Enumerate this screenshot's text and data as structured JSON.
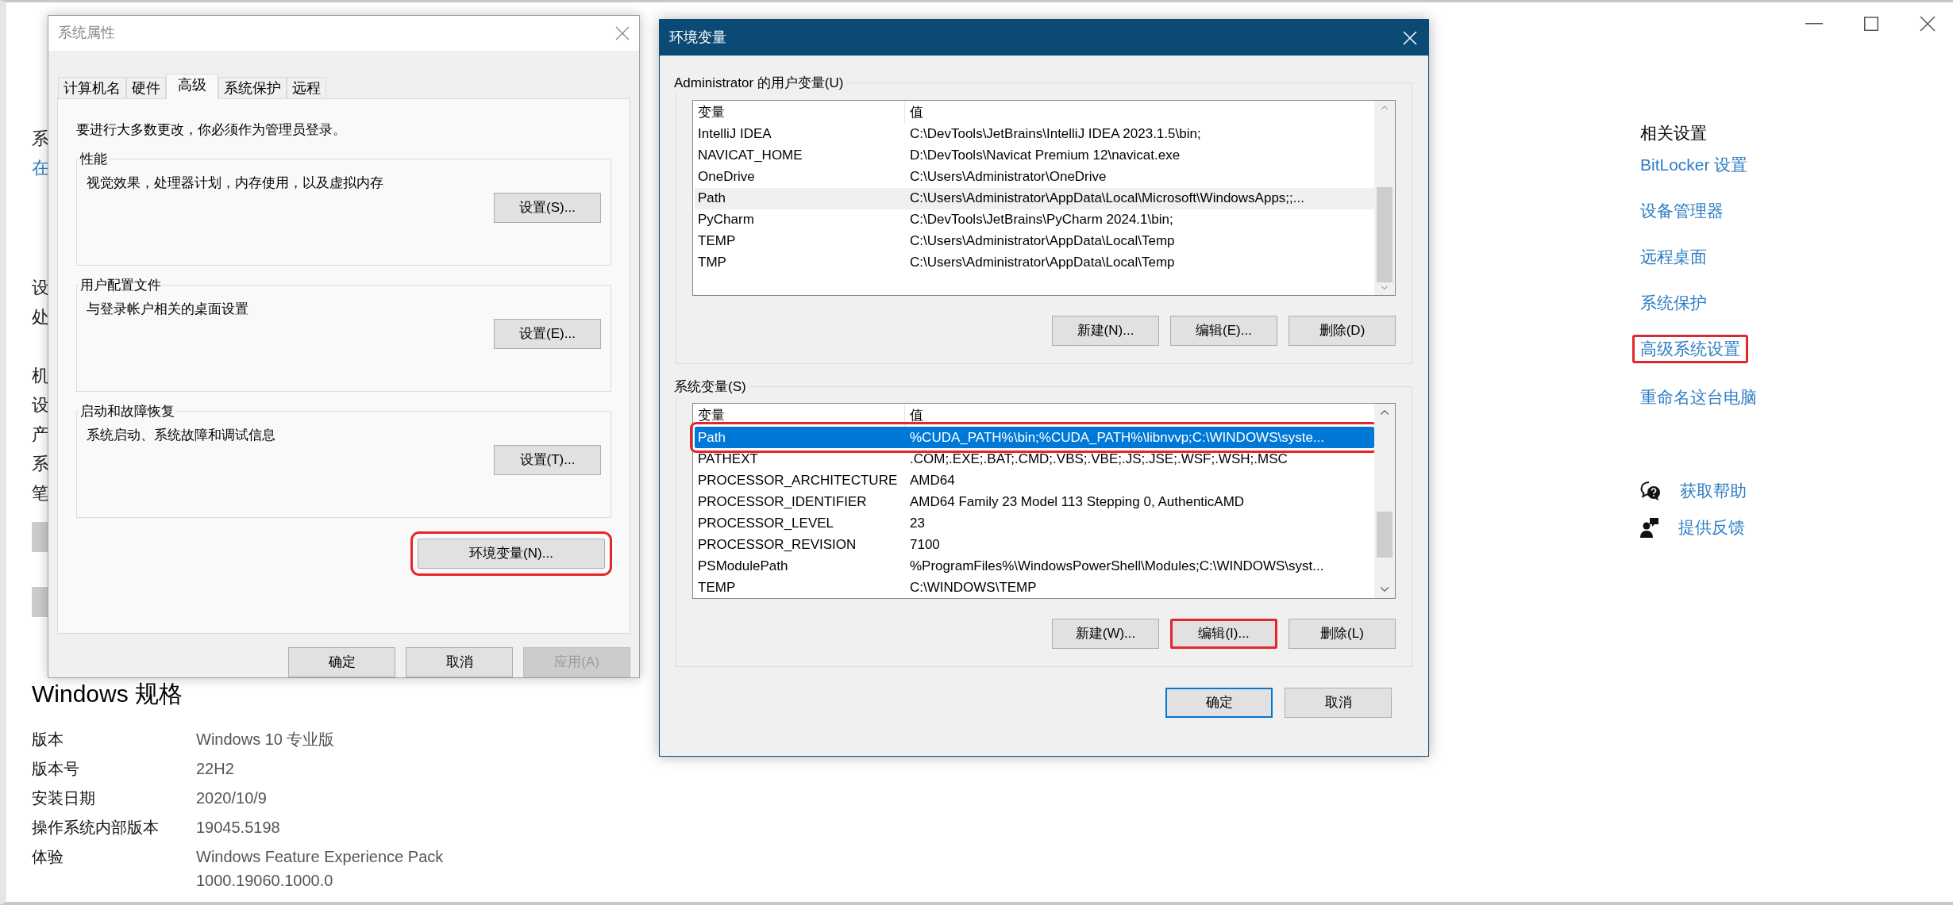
{
  "settings_window": {
    "left_fragments": [
      {
        "kind": "gap"
      },
      {
        "kind": "gap"
      },
      {
        "kind": "text",
        "text": "系"
      },
      {
        "kind": "link",
        "text": "在"
      },
      {
        "kind": "gap"
      },
      {
        "kind": "gap"
      },
      {
        "kind": "text",
        "text": "设"
      },
      {
        "kind": "text",
        "text": "处"
      },
      {
        "kind": "gap"
      },
      {
        "kind": "text",
        "text": "机"
      },
      {
        "kind": "text",
        "text": "设"
      },
      {
        "kind": "text",
        "text": "产"
      },
      {
        "kind": "text",
        "text": "系"
      },
      {
        "kind": "text",
        "text": "笔"
      },
      {
        "kind": "button"
      },
      {
        "kind": "button"
      }
    ],
    "windows_spec": {
      "title": "Windows 规格",
      "rows": [
        {
          "label": "版本",
          "value": "Windows 10 专业版"
        },
        {
          "label": "版本号",
          "value": "22H2"
        },
        {
          "label": "安装日期",
          "value": "2020/10/9"
        },
        {
          "label": "操作系统内部版本",
          "value": "19045.5198"
        },
        {
          "label": "体验",
          "value": "Windows Feature Experience Pack 1000.19060.1000.0"
        }
      ]
    },
    "related_settings": {
      "title": "相关设置",
      "links": [
        {
          "label": "BitLocker 设置",
          "highlighted": false
        },
        {
          "label": "设备管理器",
          "highlighted": false
        },
        {
          "label": "远程桌面",
          "highlighted": false
        },
        {
          "label": "系统保护",
          "highlighted": false
        },
        {
          "label": "高级系统设置",
          "highlighted": true
        },
        {
          "label": "重命名这台电脑",
          "highlighted": false
        }
      ]
    },
    "support_links": [
      {
        "kind": "help",
        "label": "获取帮助"
      },
      {
        "kind": "feedback",
        "label": "提供反馈"
      }
    ]
  },
  "system_properties": {
    "title": "系统属性",
    "tabs": [
      {
        "label": "计算机名",
        "selected": false
      },
      {
        "label": "硬件",
        "selected": false
      },
      {
        "label": "高级",
        "selected": true
      },
      {
        "label": "系统保护",
        "selected": false
      },
      {
        "label": "远程",
        "selected": false
      }
    ],
    "note": "要进行大多数更改，你必须作为管理员登录。",
    "groups": [
      {
        "title": "性能",
        "description": "视觉效果，处理器计划，内存使用，以及虚拟内存",
        "button": "设置(S)..."
      },
      {
        "title": "用户配置文件",
        "description": "与登录帐户相关的桌面设置",
        "button": "设置(E)..."
      },
      {
        "title": "启动和故障恢复",
        "description": "系统启动、系统故障和调试信息",
        "button": "设置(T)..."
      }
    ],
    "env_button": {
      "label": "环境变量(N)...",
      "highlighted": true
    },
    "buttons": [
      {
        "label": "确定",
        "disabled": false
      },
      {
        "label": "取消",
        "disabled": false
      },
      {
        "label": "应用(A)",
        "disabled": true
      }
    ]
  },
  "environment_variables": {
    "title": "环境变量",
    "user_vars": {
      "title": "Administrator 的用户变量(U)",
      "focused": false,
      "columns": [
        "变量",
        "值"
      ],
      "rows": [
        {
          "name": "IntelliJ IDEA",
          "value": "C:\\DevTools\\JetBrains\\IntelliJ IDEA 2023.1.5\\bin;",
          "selected": false,
          "highlighted": false
        },
        {
          "name": "NAVICAT_HOME",
          "value": "D:\\DevTools\\Navicat Premium 12\\navicat.exe",
          "selected": false,
          "highlighted": false
        },
        {
          "name": "OneDrive",
          "value": "C:\\Users\\Administrator\\OneDrive",
          "selected": false,
          "highlighted": false
        },
        {
          "name": "Path",
          "value": "C:\\Users\\Administrator\\AppData\\Local\\Microsoft\\WindowsApps;;...",
          "selected": true,
          "highlighted": false
        },
        {
          "name": "PyCharm",
          "value": "C:\\DevTools\\JetBrains\\PyCharm 2024.1\\bin;",
          "selected": false,
          "highlighted": false
        },
        {
          "name": "TEMP",
          "value": "C:\\Users\\Administrator\\AppData\\Local\\Temp",
          "selected": false,
          "highlighted": false
        },
        {
          "name": "TMP",
          "value": "C:\\Users\\Administrator\\AppData\\Local\\Temp",
          "selected": false,
          "highlighted": false
        }
      ],
      "buttons": [
        {
          "label": "新建(N)...",
          "highlighted": false
        },
        {
          "label": "编辑(E)...",
          "highlighted": false
        },
        {
          "label": "删除(D)",
          "highlighted": false
        }
      ]
    },
    "system_vars": {
      "title": "系统变量(S)",
      "focused": true,
      "columns": [
        "变量",
        "值"
      ],
      "rows": [
        {
          "name": "Path",
          "value": "%CUDA_PATH%\\bin;%CUDA_PATH%\\libnvvp;C:\\WINDOWS\\syste...",
          "selected": true,
          "highlighted": true
        },
        {
          "name": "PATHEXT",
          "value": ".COM;.EXE;.BAT;.CMD;.VBS;.VBE;.JS;.JSE;.WSF;.WSH;.MSC",
          "selected": false,
          "highlighted": false
        },
        {
          "name": "PROCESSOR_ARCHITECTURE",
          "value": "AMD64",
          "selected": false,
          "highlighted": false
        },
        {
          "name": "PROCESSOR_IDENTIFIER",
          "value": "AMD64 Family 23 Model 113 Stepping 0, AuthenticAMD",
          "selected": false,
          "highlighted": false
        },
        {
          "name": "PROCESSOR_LEVEL",
          "value": "23",
          "selected": false,
          "highlighted": false
        },
        {
          "name": "PROCESSOR_REVISION",
          "value": "7100",
          "selected": false,
          "highlighted": false
        },
        {
          "name": "PSModulePath",
          "value": "%ProgramFiles%\\WindowsPowerShell\\Modules;C:\\WINDOWS\\syst...",
          "selected": false,
          "highlighted": false
        },
        {
          "name": "TEMP",
          "value": "C:\\WINDOWS\\TEMP",
          "selected": false,
          "highlighted": false
        }
      ],
      "buttons": [
        {
          "label": "新建(W)...",
          "highlighted": false
        },
        {
          "label": "编辑(I)...",
          "highlighted": true
        },
        {
          "label": "删除(L)",
          "highlighted": false
        }
      ]
    },
    "buttons": [
      {
        "label": "确定",
        "default": true
      },
      {
        "label": "取消",
        "default": false
      }
    ]
  }
}
